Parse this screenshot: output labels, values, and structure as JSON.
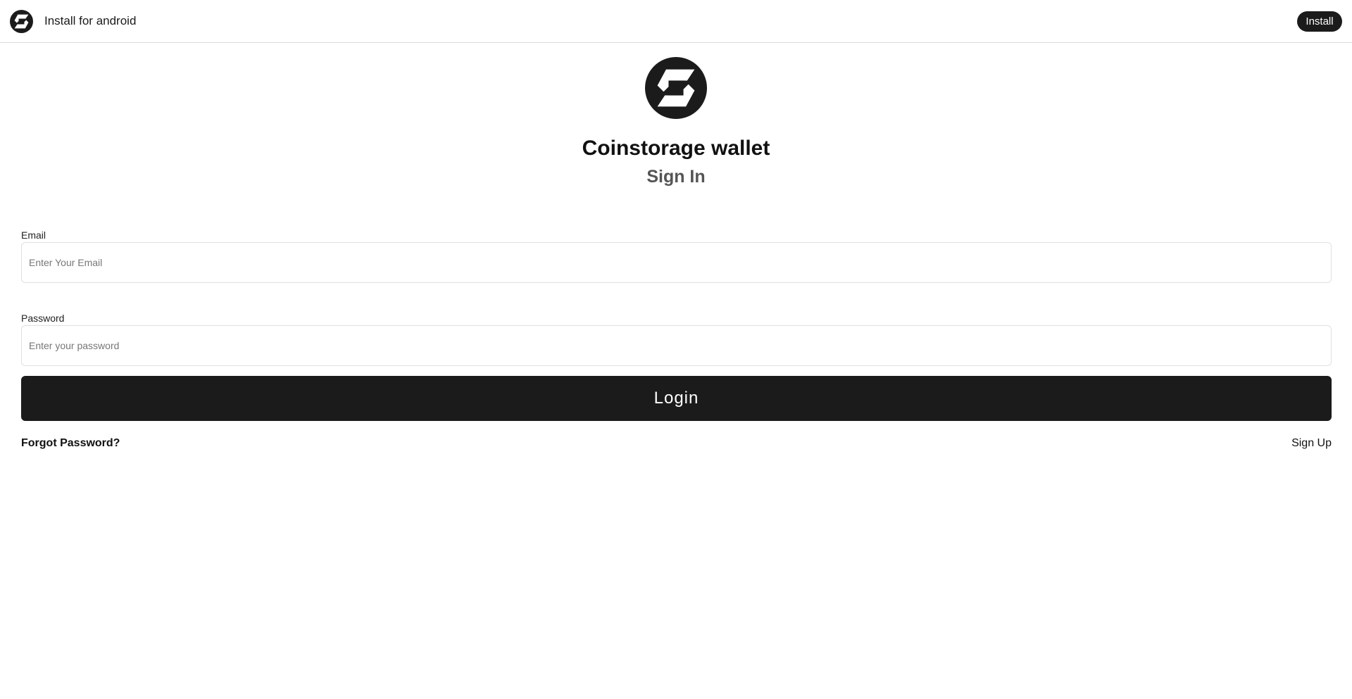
{
  "banner": {
    "text": "Install for android",
    "install_label": "Install",
    "logo_icon": "coinstorage-logo-icon"
  },
  "header": {
    "logo_icon": "coinstorage-logo-icon",
    "title": "Coinstorage wallet",
    "subtitle": "Sign In"
  },
  "form": {
    "email": {
      "label": "Email",
      "placeholder": "Enter Your Email",
      "value": ""
    },
    "password": {
      "label": "Password",
      "placeholder": "Enter your password",
      "value": ""
    },
    "login_label": "Login",
    "forgot_label": "Forgot Password?",
    "signup_label": "Sign Up"
  },
  "colors": {
    "primary": "#1b1b1b",
    "background": "#ffffff",
    "border": "#e0e0e0",
    "subtitle": "#555555"
  }
}
